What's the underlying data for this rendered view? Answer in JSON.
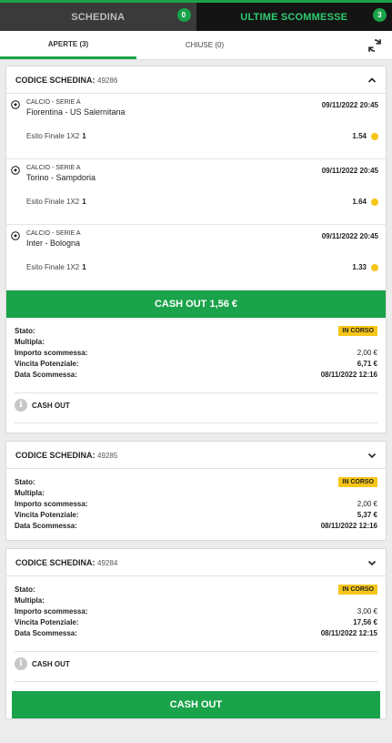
{
  "tabs": {
    "schedina": {
      "label": "SCHEDINA",
      "count": "0"
    },
    "ultime": {
      "label": "ULTIME SCOMMESSE",
      "count": "3"
    }
  },
  "subtabs": {
    "open": "APERTE (3)",
    "closed": "CHIUSE (0)"
  },
  "tickets": [
    {
      "title": "CODICE SCHEDINA:",
      "code": "49286",
      "events": [
        {
          "league": "CALCIO - SERIE A",
          "teams": "Fiorentina - US Salernitana",
          "date": "09/11/2022 20:45",
          "esito_label": "Esito Finale 1X2",
          "pick": "1",
          "odds": "1.54"
        },
        {
          "league": "CALCIO - SERIE A",
          "teams": "Torino - Sampdoria",
          "date": "09/11/2022 20:45",
          "esito_label": "Esito Finale 1X2",
          "pick": "1",
          "odds": "1.64"
        },
        {
          "league": "CALCIO - SERIE A",
          "teams": "Inter - Bologna",
          "date": "09/11/2022 20:45",
          "esito_label": "Esito Finale 1X2",
          "pick": "1",
          "odds": "1.33"
        }
      ],
      "cashout_button": "CASH OUT 1,56 €",
      "info": {
        "stato_label": "Stato:",
        "stato_value": "IN CORSO",
        "multipla_label": "Multipla:",
        "importo_label": "Importo scommessa:",
        "importo_value": "2,00 €",
        "vincita_label": "Vincita Potenziale:",
        "vincita_value": "6,71 €",
        "data_label": "Data Scommessa:",
        "data_value": "08/11/2022 12:16"
      },
      "cashout_small": "CASH OUT"
    },
    {
      "title": "CODICE SCHEDINA:",
      "code": "49285",
      "info": {
        "stato_label": "Stato:",
        "stato_value": "IN CORSO",
        "multipla_label": "Multipla:",
        "importo_label": "Importo scommessa:",
        "importo_value": "2,00 €",
        "vincita_label": "Vincita Potenziale:",
        "vincita_value": "5,37 €",
        "data_label": "Data Scommessa:",
        "data_value": "08/11/2022 12:16"
      }
    },
    {
      "title": "CODICE SCHEDINA:",
      "code": "49284",
      "info": {
        "stato_label": "Stato:",
        "stato_value": "IN CORSO",
        "multipla_label": "Multipla:",
        "importo_label": "Importo scommessa:",
        "importo_value": "3,00 €",
        "vincita_label": "Vincita Potenziale:",
        "vincita_value": "17,56 €",
        "data_label": "Data Scommessa:",
        "data_value": "08/11/2022 12:15"
      },
      "cashout_small": "CASH OUT"
    }
  ],
  "bottom_cashout": "CASH OUT",
  "colors": {
    "accent": "#1aa34a",
    "status": "#f5c518",
    "dark": "#141414"
  }
}
